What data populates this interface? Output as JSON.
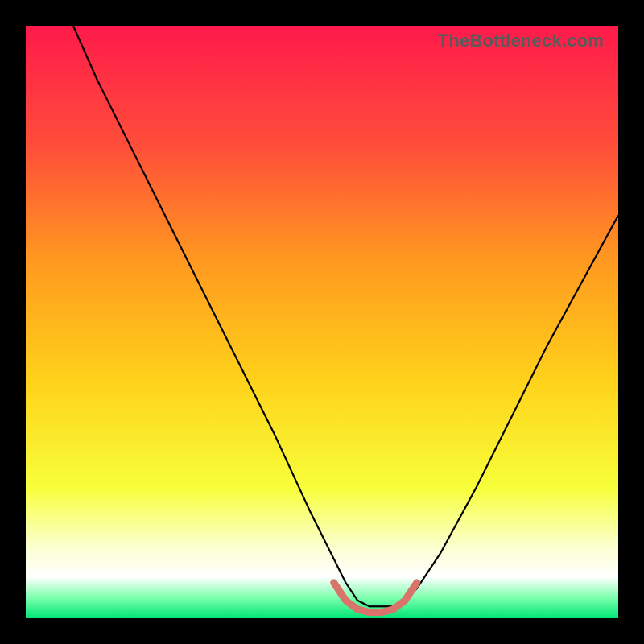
{
  "watermark": "TheBottleneck.com",
  "chart_data": {
    "type": "line",
    "title": "",
    "xlabel": "",
    "ylabel": "",
    "xlim": [
      0,
      100
    ],
    "ylim": [
      0,
      100
    ],
    "grid": false,
    "legend": false,
    "background_gradient_stops": [
      {
        "offset": 0.0,
        "color": "#ff1a4b"
      },
      {
        "offset": 0.2,
        "color": "#ff4d3a"
      },
      {
        "offset": 0.4,
        "color": "#ff9a1f"
      },
      {
        "offset": 0.6,
        "color": "#ffd21a"
      },
      {
        "offset": 0.78,
        "color": "#f7ff3a"
      },
      {
        "offset": 0.88,
        "color": "#fbffd0"
      },
      {
        "offset": 0.93,
        "color": "#ffffff"
      },
      {
        "offset": 0.965,
        "color": "#7dffad"
      },
      {
        "offset": 1.0,
        "color": "#00e676"
      }
    ],
    "series": [
      {
        "name": "bottleneck-curve",
        "color": "#000000",
        "stroke_width": 2.2,
        "x": [
          8,
          12,
          18,
          24,
          30,
          36,
          42,
          48,
          52,
          54,
          56,
          58,
          60,
          62,
          64,
          66,
          70,
          76,
          82,
          88,
          94,
          100
        ],
        "values": [
          100,
          91,
          79,
          67,
          55,
          43,
          31,
          18,
          10,
          6,
          3,
          2,
          2,
          2,
          3,
          5,
          11,
          22,
          34,
          46,
          57,
          68
        ]
      },
      {
        "name": "valley-highlight",
        "color": "#d9746c",
        "stroke_width": 9,
        "linecap": "round",
        "x": [
          52,
          54,
          56,
          58,
          60,
          62,
          64,
          66
        ],
        "values": [
          6,
          3,
          1.5,
          1,
          1,
          1.5,
          3,
          6
        ]
      }
    ]
  }
}
